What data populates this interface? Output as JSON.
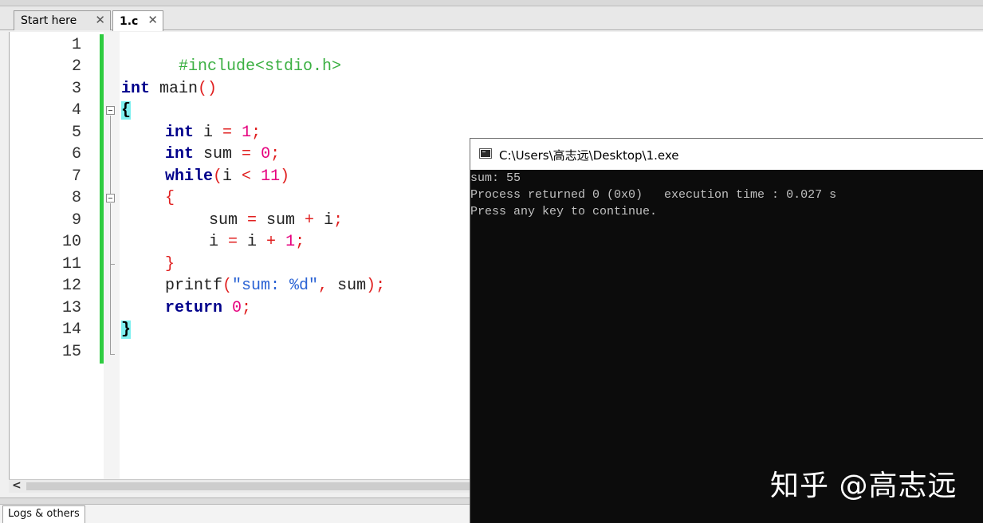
{
  "tabs": [
    {
      "label": "Start here",
      "active": false
    },
    {
      "label": "1.c",
      "active": true
    }
  ],
  "tab_close_glyph": "✕",
  "editor": {
    "line_numbers": [
      "1",
      "2",
      "3",
      "4",
      "5",
      "6",
      "7",
      "8",
      "9",
      "10",
      "11",
      "12",
      "13",
      "14",
      "15"
    ],
    "code": {
      "l1": "#include<stdio.h>",
      "l3_kw": "int",
      "l3_rest": " main",
      "l3_paren": "()",
      "l4_brace": "{",
      "l5_kw": "int",
      "l5_a": " i ",
      "l5_eq": "=",
      "l5_num": "1",
      "l5_semi": ";",
      "l6_kw": "int",
      "l6_a": " sum ",
      "l6_eq": "=",
      "l6_num": "0",
      "l6_semi": ";",
      "l7_kw": "while",
      "l7_p1": "(",
      "l7_a": "i ",
      "l7_lt": "<",
      "l7_num": "11",
      "l7_p2": ")",
      "l8_brace": "{",
      "l9_a": "sum ",
      "l9_eq": "=",
      "l9_b": " sum ",
      "l9_plus": "+",
      "l9_c": " i",
      "l9_semi": ";",
      "l10_a": "i ",
      "l10_eq": "=",
      "l10_b": " i ",
      "l10_plus": "+",
      "l10_num": "1",
      "l10_semi": ";",
      "l11_brace": "}",
      "l12_fn": "printf",
      "l12_p1": "(",
      "l12_str": "\"sum: %d\"",
      "l12_comma": ",",
      "l12_arg": " sum",
      "l12_p2": ")",
      "l12_semi": ";",
      "l13_kw": "return",
      "l13_num": "0",
      "l13_semi": ";",
      "l14_brace": "}"
    }
  },
  "scrollbar": {
    "left_arrow": "<"
  },
  "bottom_panel": {
    "tab_label": "Logs & others"
  },
  "console": {
    "title": "C:\\Users\\高志远\\Desktop\\1.exe",
    "lines": [
      "sum: 55",
      "Process returned 0 (0x0)   execution time : 0.027 s",
      "Press any key to continue."
    ]
  },
  "watermark": "知乎 @高志远",
  "colors": {
    "keyword": "#00008b",
    "preprocessor": "#3cb043",
    "number": "#e6007e",
    "operator": "#e02020",
    "string": "#2962d4",
    "brace_match_bg": "#7ff0f0",
    "change_bar": "#2ecc40",
    "console_bg": "#0c0c0c",
    "console_text": "#c0c0c0"
  }
}
